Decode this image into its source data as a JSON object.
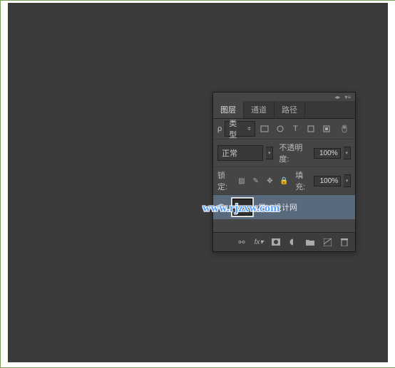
{
  "tabs": {
    "layers": "图层",
    "channels": "通道",
    "paths": "路径"
  },
  "filter": {
    "label": "类型"
  },
  "blend": {
    "mode": "正常",
    "opacity_label": "不透明度:",
    "opacity": "100%"
  },
  "lock": {
    "label": "锁定:",
    "fill_label": "填充:",
    "fill": "100%"
  },
  "layer": {
    "name": "学UI设计网"
  },
  "watermark": "www.rjzxw.com"
}
